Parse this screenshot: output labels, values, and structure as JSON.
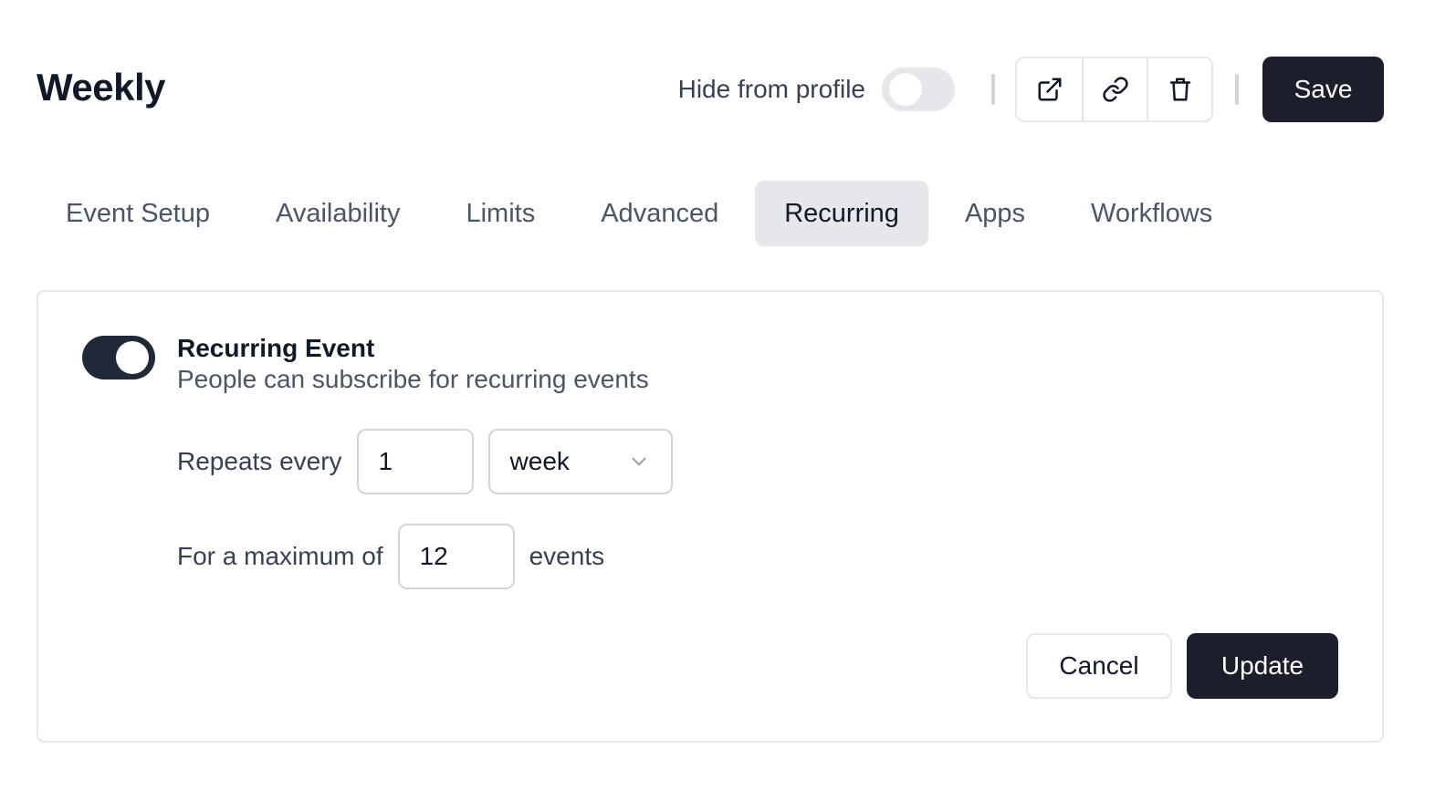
{
  "header": {
    "title": "Weekly",
    "hide_label": "Hide from profile",
    "hide_toggle_state": "off",
    "save_label": "Save",
    "icons": [
      "external-link-icon",
      "link-icon",
      "trash-icon"
    ]
  },
  "tabs": [
    {
      "label": "Event Setup",
      "active": false
    },
    {
      "label": "Availability",
      "active": false
    },
    {
      "label": "Limits",
      "active": false
    },
    {
      "label": "Advanced",
      "active": false
    },
    {
      "label": "Recurring",
      "active": true
    },
    {
      "label": "Apps",
      "active": false
    },
    {
      "label": "Workflows",
      "active": false
    }
  ],
  "recurring": {
    "toggle_state": "on",
    "title": "Recurring Event",
    "description": "People can subscribe for recurring events",
    "repeats_label": "Repeats every",
    "repeats_value": "1",
    "frequency_selected": "week",
    "max_label": "For a maximum of",
    "max_value": "12",
    "events_suffix": "events",
    "cancel_label": "Cancel",
    "update_label": "Update"
  },
  "colors": {
    "primary": "#1c1f2b",
    "border": "#e5e7eb",
    "active_tab": "#e5e7eb"
  }
}
